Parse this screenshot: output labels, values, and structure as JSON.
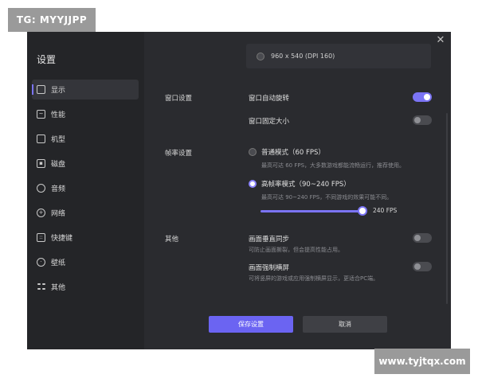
{
  "watermarks": {
    "top": "TG: MYYJJPP",
    "bottom": "www.tyjtqx.com"
  },
  "sidebar": {
    "title": "设置",
    "items": [
      {
        "label": "显示",
        "icon": "monitor-icon",
        "active": true
      },
      {
        "label": "性能",
        "icon": "performance-icon",
        "active": false
      },
      {
        "label": "机型",
        "icon": "device-icon",
        "active": false
      },
      {
        "label": "磁盘",
        "icon": "disk-icon",
        "active": false
      },
      {
        "label": "音频",
        "icon": "audio-icon",
        "active": false
      },
      {
        "label": "网络",
        "icon": "network-icon",
        "active": false
      },
      {
        "label": "快捷键",
        "icon": "keyboard-icon",
        "active": false
      },
      {
        "label": "壁纸",
        "icon": "wallpaper-icon",
        "active": false
      },
      {
        "label": "其他",
        "icon": "apps-icon",
        "active": false
      }
    ]
  },
  "resolution": {
    "option": "960 x 540  (DPI 160)"
  },
  "window_settings": {
    "section": "窗口设置",
    "auto_rotate": {
      "label": "窗口自动旋转",
      "enabled": true
    },
    "fixed_size": {
      "label": "窗口固定大小",
      "enabled": false
    }
  },
  "frame_rate": {
    "section": "帧率设置",
    "normal": {
      "label": "普通模式（60 FPS）",
      "desc": "最高可达 60 FPS，大多数游戏都能流畅运行，推荐使用。",
      "selected": false
    },
    "high": {
      "label": "高帧率模式（90~240 FPS）",
      "desc": "最高可达 90~240 FPS，不同游戏的效果可能不同。",
      "selected": true
    },
    "slider_value": "240 FPS"
  },
  "other": {
    "section": "其他",
    "vsync": {
      "label": "画面垂直同步",
      "desc": "可防止画面撕裂，但会提高性能占用。",
      "enabled": false
    },
    "force_landscape": {
      "label": "画面强制横屏",
      "desc": "可将竖屏的游戏或应用强制横屏显示，更适合PC端。",
      "enabled": false
    }
  },
  "buttons": {
    "save": "保存设置",
    "cancel": "取消"
  },
  "colors": {
    "accent": "#7b74f5",
    "panel": "#2a2b2f",
    "sidebar": "#242528"
  }
}
